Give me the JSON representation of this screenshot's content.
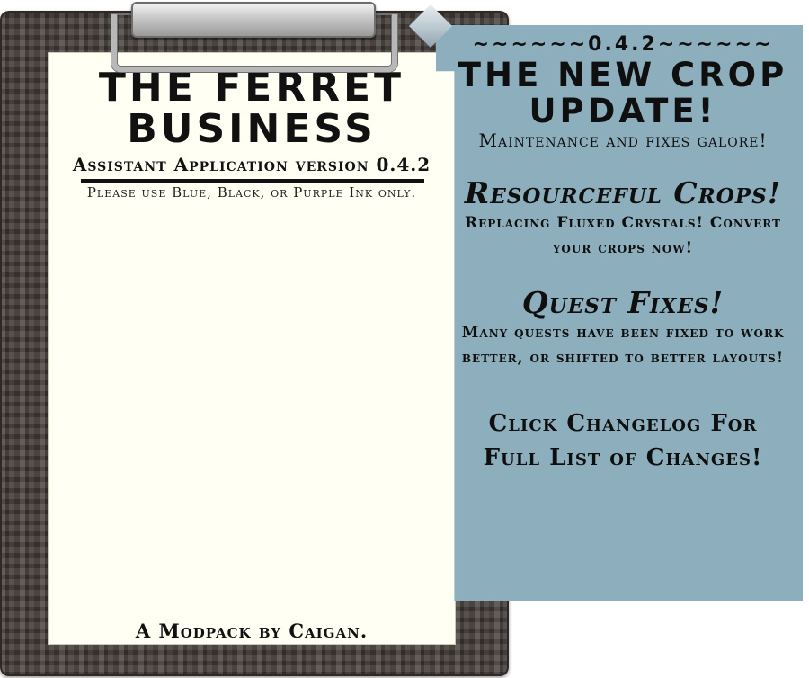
{
  "paper": {
    "title_line1": "THE FERRET",
    "title_line2": "BUSINESS",
    "subtitle": "Assistant Application version 0.4.2",
    "ink_note": "Please use Blue, Black, or Purple Ink only.",
    "credit": "A Modpack by Caigan."
  },
  "note": {
    "version_banner": "~~~~~~0.4.2~~~~~~",
    "headline": "THE NEW CROP UPDATE!",
    "tagline": "Maintenance and fixes galore!",
    "sections": [
      {
        "heading": "Resourceful Crops!",
        "body": "Replacing Fluxed Crystals! Convert your crops now!"
      },
      {
        "heading": "Quest Fixes!",
        "body": "Many quests have been fixed to work better, or shifted to better layouts!"
      }
    ],
    "call_to_action": "Click Changelog For Full List of Changes!"
  }
}
